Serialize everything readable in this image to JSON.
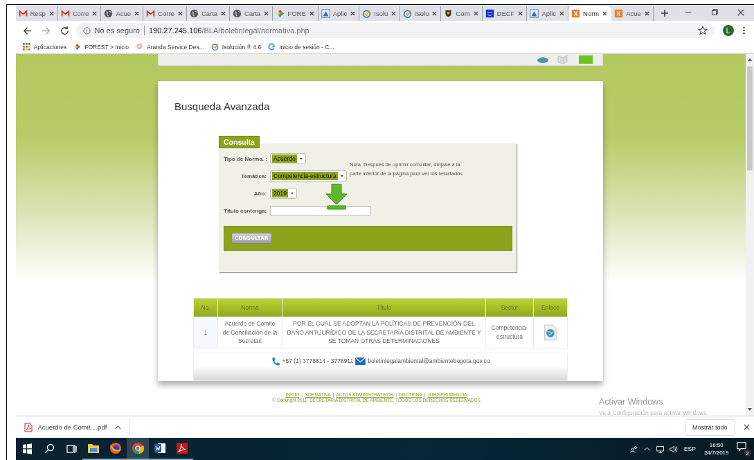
{
  "browser": {
    "tabs": [
      {
        "label": "Resp",
        "kind": "gmail",
        "selected": false
      },
      {
        "label": "Corre",
        "kind": "gmail",
        "selected": false
      },
      {
        "label": "Acue",
        "kind": "globe",
        "selected": false
      },
      {
        "label": "Corre",
        "kind": "gmail",
        "selected": false
      },
      {
        "label": "Carta",
        "kind": "globe",
        "selected": false
      },
      {
        "label": "Carta",
        "kind": "globe",
        "selected": false
      },
      {
        "label": "FORE",
        "kind": "forest",
        "selected": false
      },
      {
        "label": "Aplic",
        "kind": "aplic",
        "selected": false
      },
      {
        "label": "Isolu",
        "kind": "isolucion",
        "selected": false
      },
      {
        "label": "Isolu",
        "kind": "isolucion",
        "selected": false
      },
      {
        "label": "Com",
        "kind": "shield",
        "selected": false
      },
      {
        "label": "DECF",
        "kind": "dec",
        "selected": false
      },
      {
        "label": "Aplic",
        "kind": "aplic",
        "selected": false
      },
      {
        "label": "Norm",
        "kind": "xampp",
        "selected": true
      },
      {
        "label": "Acue",
        "kind": "xampp",
        "selected": false
      }
    ],
    "address": {
      "security": "No es seguro",
      "host": "190.27.245.106",
      "path": "/BLA/boletinlegal/normativa.php"
    },
    "profile_initial": "L",
    "bookmarks": [
      {
        "label": "Aplicaciones",
        "kind": "apps"
      },
      {
        "label": "FOREST > Inicio",
        "kind": "forest"
      },
      {
        "label": "Aranda Service Des...",
        "kind": "aranda"
      },
      {
        "label": "Isolución ® 4.6",
        "kind": "isolucion"
      },
      {
        "label": "Inicio de sesión - C...",
        "kind": "google"
      }
    ]
  },
  "page": {
    "title": "Busqueda Avanzada",
    "form": {
      "legend": "Consulta",
      "fields": [
        {
          "label": "Tipo de Norma. :",
          "kind": "select",
          "value": "Acuerdo"
        },
        {
          "label": "Temática:",
          "kind": "select",
          "value": "Competencia-estructura"
        },
        {
          "label": "Año:",
          "kind": "select",
          "value": "2019"
        },
        {
          "label": "Título contenga:",
          "kind": "text"
        }
      ],
      "note": "Nota: Después de oprimir consultar, diríjase a la parte inferior de la página para ver los resultados",
      "button": "CONSULTAR"
    },
    "table": {
      "columns": [
        "No.",
        "Norma",
        "Título",
        "Sector",
        "Enlace"
      ],
      "rows": [
        {
          "no": "1",
          "norma": "Acuerdo de Comite de Conciliación de la Secretari",
          "titulo": "POR EL CUAL SE ADOPTAN LA POLÍTICAS DE PREVENCIÓN DEL DAÑO ANTIJURÍDICO DE LA SECRETARÍA DISTRITAL DE AMBIENTE Y SE TOMAN OTRAS DETERMINACIONES",
          "sector": "Competencia-estructura"
        }
      ]
    },
    "contact": {
      "phone": "+57 (1) 3778814 - 3778911",
      "email": "boletinlegalambiental@ambientebogota.gov.co"
    },
    "footer": {
      "items": [
        {
          "kind": "link",
          "text": "INICIO"
        },
        {
          "kind": "separator",
          "text": "|"
        },
        {
          "kind": "link",
          "text": "NORMATIVA"
        },
        {
          "kind": "separator",
          "text": "|"
        },
        {
          "kind": "link",
          "text": "ACTOS ADMINISTRATIVOS"
        },
        {
          "kind": "separator",
          "text": "|"
        },
        {
          "kind": "link",
          "text": "DOCTRINA"
        },
        {
          "kind": "separator",
          "text": "|"
        },
        {
          "kind": "link",
          "text": "JURISPRUDENCIA"
        }
      ],
      "copyright": "© Copyright 2011. SECRETARIA DISTRITAL DE AMBIENTE. TODOS LOS DERECHOS RESERVADOS"
    }
  },
  "activation": {
    "title": "Activar Windows",
    "subtitle": "Ve a Configuración para activar Windows."
  },
  "downloads": {
    "file": "Acuerdo de Comit....pdf",
    "show_all": "Mostrar todo"
  },
  "taskbar": {
    "apps": [
      {
        "kind": "explorer",
        "selected": false
      },
      {
        "kind": "firefox",
        "selected": false
      },
      {
        "kind": "chrome",
        "selected": true
      },
      {
        "kind": "word",
        "selected": false
      },
      {
        "kind": "acrobat",
        "selected": false
      }
    ],
    "language": "ESP",
    "time": "16:50",
    "date": "24/7/2019",
    "notifications": "2"
  }
}
